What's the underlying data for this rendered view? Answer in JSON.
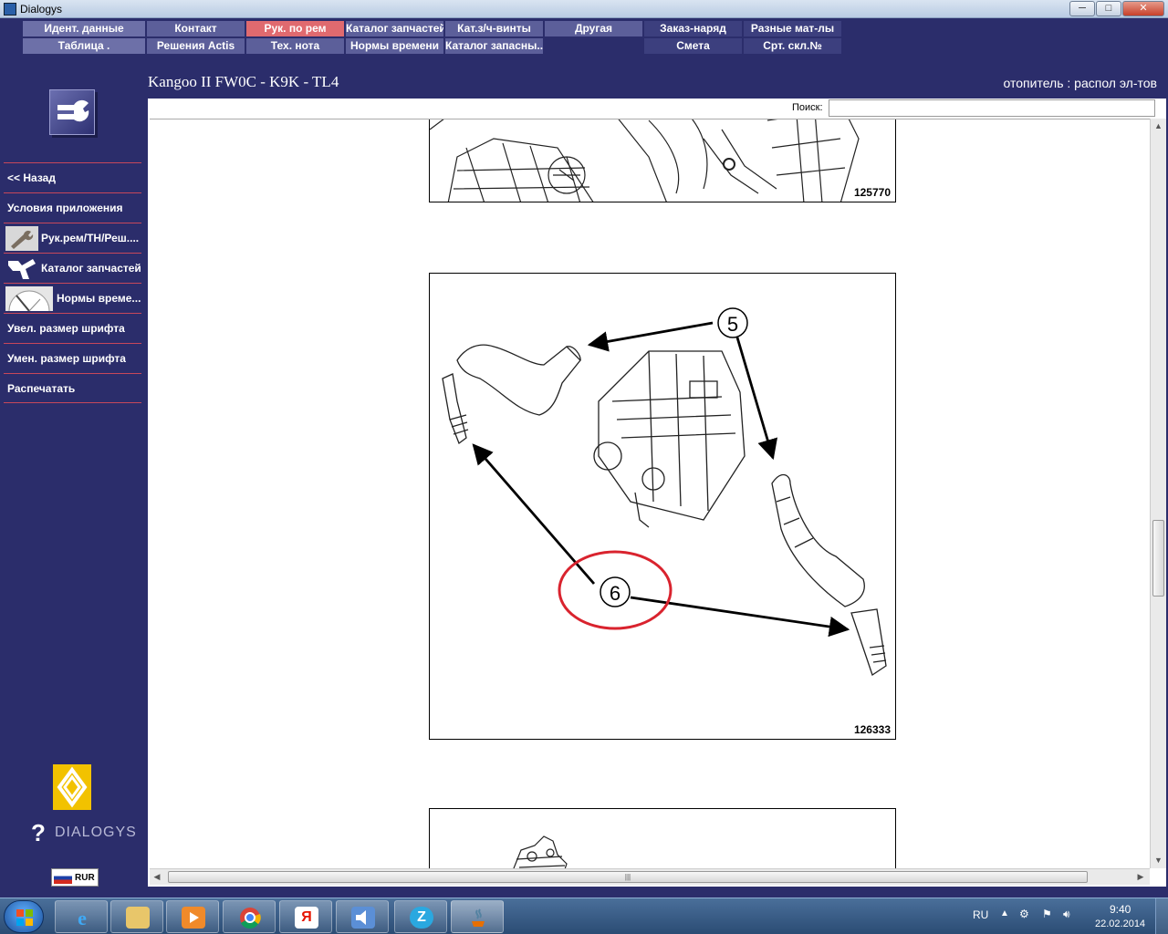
{
  "window": {
    "title": "Dialogys",
    "minimize_glyph": "─",
    "maximize_glyph": "□",
    "close_glyph": "✕"
  },
  "menu": {
    "row1": [
      "Идент. данные",
      "Контакт",
      "Рук. по рем",
      "Каталог запчастей",
      "Кат.з/ч-винты",
      "Другая",
      "Заказ-наряд",
      "Разные мат-лы"
    ],
    "row2": [
      "Таблица .",
      "Решения Actis",
      "Тех. нота",
      "Нормы времени",
      "Каталог запасны...",
      "Смета",
      "Срт. скл.№"
    ],
    "active": "Рук. по рем"
  },
  "header": {
    "title": "Kangoo II FW0C - K9K - TL4",
    "section": "отопитель : распол эл-тов"
  },
  "sidebar": {
    "items": [
      {
        "label": "<< Назад",
        "icon": "back"
      },
      {
        "label": "Условия приложения",
        "icon": ""
      },
      {
        "label": "Рук.рем/ТН/Реш....",
        "icon": "wrench-thumbnail-icon"
      },
      {
        "label": "Каталог запчастей",
        "icon": "parts-thumbnail-icon"
      },
      {
        "label": "Нормы време...",
        "icon": "clock-thumbnail-icon"
      },
      {
        "label": "Увел. размер шрифта",
        "icon": ""
      },
      {
        "label": "Умен. размер шрифта",
        "icon": ""
      },
      {
        "label": "Распечатать",
        "icon": ""
      }
    ],
    "brand": "DIALOGYS",
    "brand_mark": "?",
    "language": "RUR"
  },
  "search": {
    "label": "Поиск:",
    "value": "",
    "placeholder": ""
  },
  "figures": [
    {
      "id": "125770"
    },
    {
      "id": "126333",
      "callouts": [
        "5",
        "6"
      ]
    }
  ],
  "taskbar": {
    "apps": [
      "ie-icon",
      "explorer-icon",
      "media-player-icon",
      "chrome-icon",
      "yandex-icon",
      "sound-app-icon",
      "zona-icon",
      "java-icon"
    ],
    "yandex_letter": "Я",
    "zona_letter": "Z",
    "language": "RU",
    "time": "9:40",
    "date": "22.02.2014"
  },
  "colors": {
    "app_bg": "#2b2d6b",
    "menu_active": "#e06a6f",
    "separator": "#c7475a",
    "highlight_circle": "#d9232e"
  }
}
